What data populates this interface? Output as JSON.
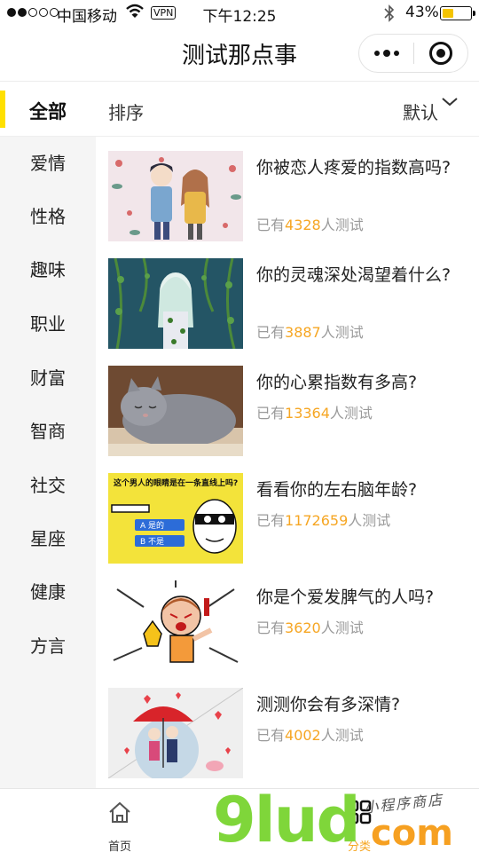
{
  "status_bar": {
    "carrier": "中国移动",
    "vpn": "VPN",
    "time": "下午12:25",
    "battery_pct": "43%",
    "battery_level": 0.43,
    "battery_color": "#f5c400"
  },
  "nav": {
    "title": "测试那点事",
    "icons": [
      "more-dots-icon",
      "close-circle-icon"
    ]
  },
  "filter": {
    "all_label": "全部",
    "sort_label": "排序",
    "default_label": "默认",
    "accent_color": "#ffe000"
  },
  "categories": [
    "爱情",
    "性格",
    "趣味",
    "职业",
    "财富",
    "智商",
    "社交",
    "星座",
    "健康",
    "方言"
  ],
  "quizzes": [
    {
      "title": "你被恋人疼爱的指数高吗?",
      "prefix": "已有",
      "count": "4328",
      "suffix": "人测试"
    },
    {
      "title": "你的灵魂深处渴望着什么?",
      "prefix": "已有",
      "count": "3887",
      "suffix": "人测试"
    },
    {
      "title": "你的心累指数有多高?",
      "prefix": "已有",
      "count": "13364",
      "suffix": "人测试"
    },
    {
      "title": "看看你的左右脑年龄?",
      "prefix": "已有",
      "count": "1172659",
      "suffix": "人测试"
    },
    {
      "title": "你是个爱发脾气的人吗?",
      "prefix": "已有",
      "count": "3620",
      "suffix": "人测试"
    },
    {
      "title": "测测你会有多深情?",
      "prefix": "已有",
      "count": "4002",
      "suffix": "人测试"
    }
  ],
  "thumb_texts": {
    "brain_banner": "这个男人的眼睛是在一条直线上吗?",
    "brain_option_a": "A 是的",
    "brain_option_b": "B 不是"
  },
  "tabs": [
    {
      "label": "首页",
      "icon": "home-icon",
      "color": "#333333"
    },
    {
      "label": "分类",
      "icon": "grid-icon",
      "color": "#f6a623"
    }
  ],
  "watermark": {
    "brand": "9lud",
    "suffix": "com",
    "script": "小程序商店"
  },
  "colors": {
    "count_highlight": "#f6a623",
    "meta_gray": "#9a9a9a",
    "sidebar_bg": "#f5f5f5"
  }
}
